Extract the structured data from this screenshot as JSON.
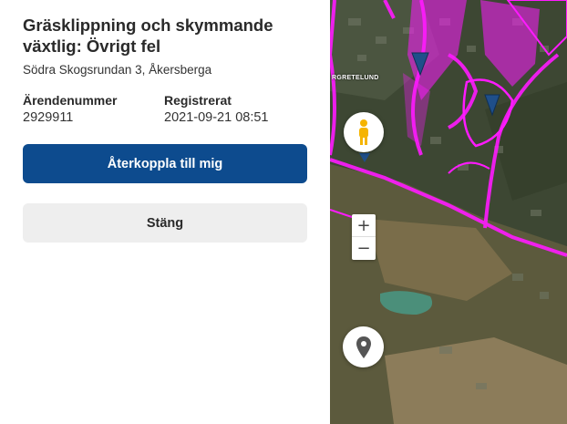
{
  "case": {
    "title": "Gräsklippning och skymmande växtlig: Övrigt fel",
    "address": "Södra Skogsrundan 3, Åkersberga",
    "number_label": "Ärendenummer",
    "number_value": "2929911",
    "registered_label": "Registrerat",
    "registered_value": "2021-09-21 08:51"
  },
  "actions": {
    "reconnect_label": "Återkoppla till mig",
    "close_label": "Stäng"
  },
  "map": {
    "place_label": "RGRETELUND",
    "zoom_in_label": "+",
    "zoom_out_label": "−",
    "street_view_icon": "pegman-icon",
    "locate_icon": "location-pin-icon",
    "marker_icon": "triangle-marker-icon",
    "road_color": "#ff1aff",
    "marker_color": "#1f4f8a"
  },
  "colors": {
    "primary_button": "#0d4b8e",
    "secondary_button": "#eeeeee"
  }
}
